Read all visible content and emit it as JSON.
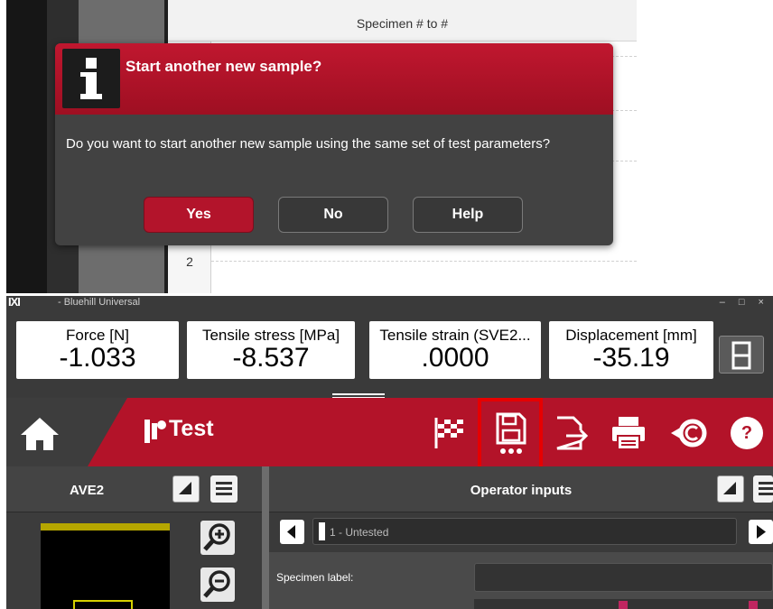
{
  "dialog": {
    "title": "Start another new sample?",
    "message": "Do you want to start another new sample using the same set of test parameters?",
    "buttons": {
      "yes": "Yes",
      "no": "No",
      "help": "Help"
    }
  },
  "background_table": {
    "header": "Specimen # to #",
    "row_numbers": [
      "2"
    ]
  },
  "titlebar": {
    "app_name": "- Bluehill Universal",
    "logo": "IXI",
    "window_controls": "– □ ×"
  },
  "meters": [
    {
      "label": "Force [N]",
      "value": "-1.033"
    },
    {
      "label": "Tensile stress [MPa]",
      "value": "-8.537"
    },
    {
      "label": "Tensile strain (SVE2...",
      "value": ".0000"
    },
    {
      "label": "Displacement [mm]",
      "value": "-35.19"
    }
  ],
  "toolbar": {
    "section_label": "Test",
    "icons": [
      "home-icon",
      "test-icon",
      "finish-flag-icon",
      "save-icon",
      "export-icon",
      "print-icon",
      "copyright-icon",
      "help-icon"
    ],
    "highlighted": "save-icon",
    "help_glyph": "?"
  },
  "left_pane": {
    "title": "AVE2"
  },
  "right_pane": {
    "title": "Operator inputs",
    "specimen_selector": "1 - Untested",
    "specimen_label_caption": "Specimen label:"
  },
  "colors": {
    "accent_red": "#b31329",
    "highlight_box": "#e60000",
    "dialog_bg": "#424242"
  }
}
